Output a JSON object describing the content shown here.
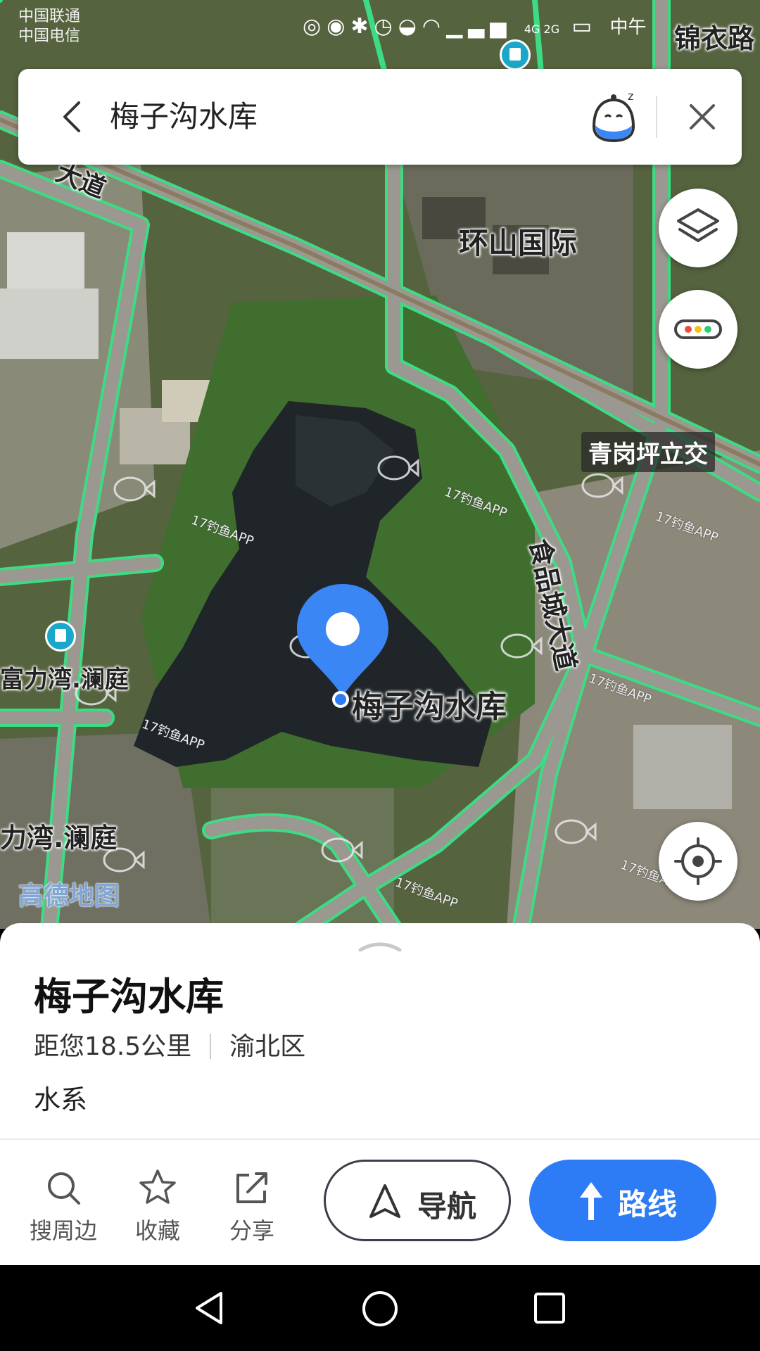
{
  "status_bar": {
    "carrier_line1": "中国联通",
    "carrier_line2": "中国电信",
    "network": "4G 2G",
    "time": "中午"
  },
  "search": {
    "query": "梅子沟水库"
  },
  "map": {
    "labels": {
      "huanshan": "环山国际",
      "qinggangping": "青岗坪立交",
      "shipincheng": "食品城大道",
      "fuliwan_1": "富力湾.澜庭",
      "fuliwan_2": "力湾.澜庭",
      "jinyi_road": "锦衣路",
      "road_top_left": "大道"
    },
    "fishing_tags": [
      "17钓鱼APP",
      "17钓鱼APP",
      "17钓鱼APP",
      "17钓鱼APP",
      "17钓鱼APP",
      "17钓鱼APP",
      "17钓鱼APP"
    ],
    "pin_label": "梅子沟水库",
    "logo": "高德地图"
  },
  "place": {
    "name": "梅子沟水库",
    "distance": "距您18.5公里",
    "district": "渝北区",
    "category": "水系"
  },
  "actions": {
    "search_nearby": "搜周边",
    "favorite": "收藏",
    "share": "分享",
    "navigate": "导航",
    "route": "路线"
  },
  "colors": {
    "accent": "#2d7cf6",
    "road": "#3ddc84",
    "poi": "#1aa7c9"
  },
  "icons": [
    "back-icon",
    "voice-assistant-icon",
    "close-icon",
    "layers-icon",
    "traffic-icon",
    "locate-icon",
    "search-icon",
    "star-icon",
    "share-icon",
    "navigate-icon",
    "route-icon",
    "android-back-icon",
    "android-home-icon",
    "android-recents-icon"
  ]
}
